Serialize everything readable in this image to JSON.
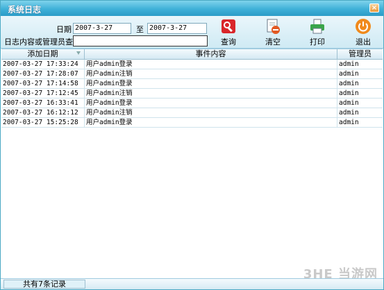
{
  "window": {
    "title": "系统日志",
    "close_glyph": "×"
  },
  "filter": {
    "date_label": "日期",
    "date_from": "2007-3-27",
    "to_label": "至",
    "date_to": "2007-3-27",
    "query_label": "日志内容或管理员查询",
    "query_value": ""
  },
  "toolbar": {
    "query_label": "查询",
    "clear_label": "清空",
    "print_label": "打印",
    "exit_label": "退出"
  },
  "table": {
    "columns": [
      "添加日期",
      "事件内容",
      "管理员"
    ],
    "rows": [
      [
        "2007-03-27 17:33:24",
        "用户admin登录",
        "admin"
      ],
      [
        "2007-03-27 17:28:07",
        "用户admin注销",
        "admin"
      ],
      [
        "2007-03-27 17:14:58",
        "用户admin登录",
        "admin"
      ],
      [
        "2007-03-27 17:12:45",
        "用户admin注销",
        "admin"
      ],
      [
        "2007-03-27 16:33:41",
        "用户admin登录",
        "admin"
      ],
      [
        "2007-03-27 16:12:12",
        "用户admin注销",
        "admin"
      ],
      [
        "2007-03-27 15:25:28",
        "用户admin登录",
        "admin"
      ]
    ]
  },
  "status": {
    "record_count": "共有7条记录"
  },
  "watermark": "3HE 当游网",
  "colors": {
    "titlebar": "#3fb0d8",
    "accent": "#4ba9c4"
  }
}
